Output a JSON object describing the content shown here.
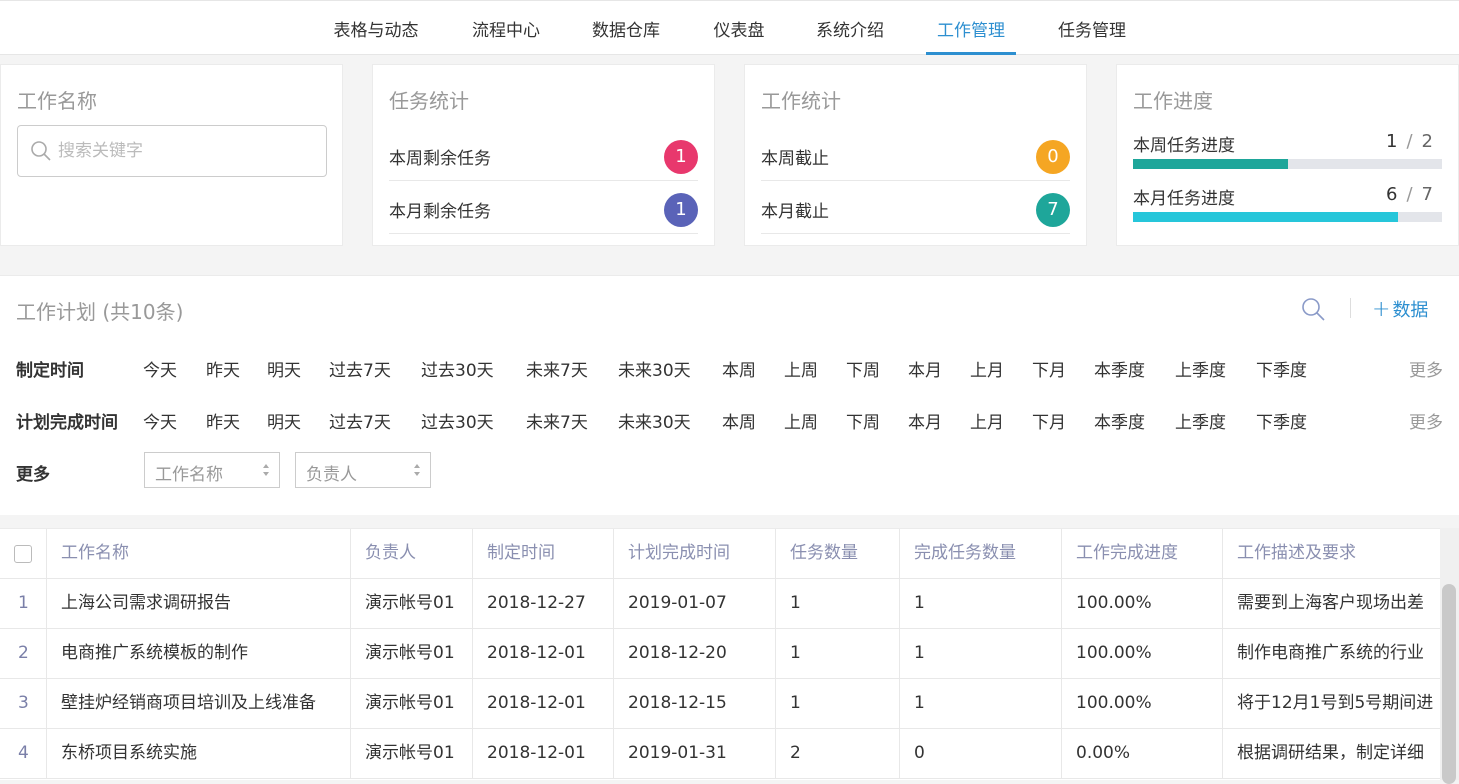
{
  "nav": {
    "tabs": [
      "表格与动态",
      "流程中心",
      "数据仓库",
      "仪表盘",
      "系统介绍",
      "工作管理",
      "任务管理"
    ],
    "active": "工作管理"
  },
  "work_name_card": {
    "title": "工作名称",
    "search_placeholder": "搜索关键字"
  },
  "task_stats": {
    "title": "任务统计",
    "rows": [
      {
        "label": "本周剩余任务",
        "count": "1",
        "color": "#e8386d"
      },
      {
        "label": "本月剩余任务",
        "count": "1",
        "color": "#5a63b8"
      }
    ]
  },
  "work_stats": {
    "title": "工作统计",
    "rows": [
      {
        "label": "本周截止",
        "count": "0",
        "color": "#f5a623"
      },
      {
        "label": "本月截止",
        "count": "7",
        "color": "#1ea69a"
      }
    ]
  },
  "work_progress": {
    "title": "工作进度",
    "rows": [
      {
        "label": "本周任务进度",
        "done": "1",
        "sep": "/",
        "total": "2",
        "fraction": 0.5,
        "color": "#1ea69a"
      },
      {
        "label": "本月任务进度",
        "done": "6",
        "sep": "/",
        "total": "7",
        "fraction": 0.857,
        "color": "#26c6da"
      }
    ]
  },
  "plan": {
    "title": "工作计划 (共10条)",
    "add_label": "数据",
    "filters": [
      {
        "label": "制定时间",
        "options": [
          "今天",
          "昨天",
          "明天",
          "过去7天",
          "过去30天",
          "未来7天",
          "未来30天",
          "本周",
          "上周",
          "下周",
          "本月",
          "上月",
          "下月",
          "本季度",
          "上季度",
          "下季度"
        ],
        "more": "更多"
      },
      {
        "label": "计划完成时间",
        "options": [
          "今天",
          "昨天",
          "明天",
          "过去7天",
          "过去30天",
          "未来7天",
          "未来30天",
          "本周",
          "上周",
          "下周",
          "本月",
          "上月",
          "下月",
          "本季度",
          "上季度",
          "下季度"
        ],
        "more": "更多"
      }
    ],
    "more_label": "更多",
    "selects": [
      "工作名称",
      "负责人"
    ]
  },
  "table": {
    "headers": [
      "工作名称",
      "负责人",
      "制定时间",
      "计划完成时间",
      "任务数量",
      "完成任务数量",
      "工作完成进度",
      "工作描述及要求"
    ],
    "rows": [
      [
        "1",
        "上海公司需求调研报告",
        "演示帐号01",
        "2018-12-27",
        "2019-01-07",
        "1",
        "1",
        "100.00%",
        "需要到上海客户现场出差"
      ],
      [
        "2",
        "电商推广系统模板的制作",
        "演示帐号01",
        "2018-12-01",
        "2018-12-20",
        "1",
        "1",
        "100.00%",
        "制作电商推广系统的行业"
      ],
      [
        "3",
        "壁挂炉经销商项目培训及上线准备",
        "演示帐号01",
        "2018-12-01",
        "2018-12-15",
        "1",
        "1",
        "100.00%",
        "将于12月1号到5号期间进"
      ],
      [
        "4",
        "东桥项目系统实施",
        "演示帐号01",
        "2018-12-01",
        "2019-01-31",
        "2",
        "0",
        "0.00%",
        "根据调研结果，制定详细"
      ]
    ]
  }
}
